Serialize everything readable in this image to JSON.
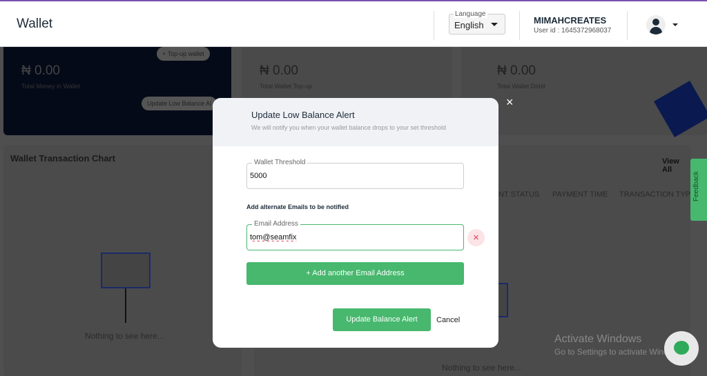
{
  "header": {
    "title": "Wallet",
    "language_label": "Language",
    "language_value": "English",
    "user_name": "MIMAHCREATES",
    "user_id": "User id : 1645372968037"
  },
  "cards": [
    {
      "amount": "₦ 0.00",
      "label": "Total Money in Wallet",
      "topup": "+ Top-up wallet",
      "update": "Update Low Balance Al"
    },
    {
      "amount": "₦ 0.00",
      "label": "Total Wallet Top-up"
    },
    {
      "amount": "₦ 0.00",
      "label": "Total Wallet Debit"
    }
  ],
  "chart_panel": {
    "title": "Wallet Transaction Chart",
    "empty": "Nothing to see here..."
  },
  "transactions": {
    "view_all": "View All",
    "columns": [
      "NT STATUS",
      "PAYMENT TIME",
      "TRANSACTION TYPE"
    ],
    "empty": "Nothing to see here..."
  },
  "feedback": "Feedback",
  "activate": {
    "title": "Activate Windows",
    "sub": "Go to Settings to activate Windows."
  },
  "modal": {
    "title": "Update Low Balance Alert",
    "subtitle": "We will notify you when your wallet balance drops to your set threshold",
    "threshold_label": "Wallet Threshold",
    "threshold_value": "5000",
    "emails_label": "Add alternate Emails to be notified",
    "email_label": "Email Address",
    "email_value": "tom@seamfix",
    "remove": "×",
    "add_email": "+ Add another Email Address",
    "submit": "Update Balance Alert",
    "cancel": "Cancel",
    "close": "×"
  }
}
